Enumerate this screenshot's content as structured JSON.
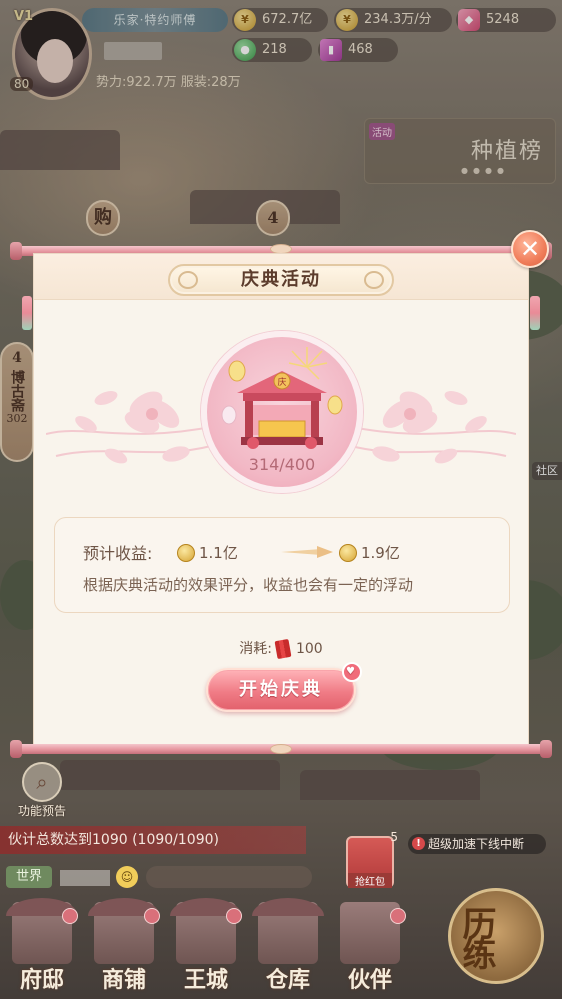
{
  "hud": {
    "vip": "V1",
    "level": "80",
    "title": "乐家·特约师傅",
    "power_label": "势力:922.7万 服装:28万",
    "resources": [
      {
        "name": "silver",
        "icon": "coin-icon",
        "value": "672.7亿"
      },
      {
        "name": "income_rate",
        "icon": "coin-stack-icon",
        "value": "234.3万/分"
      },
      {
        "name": "gems",
        "icon": "gem-icon",
        "value": "5248"
      },
      {
        "name": "jade",
        "icon": "jade-icon",
        "value": "218"
      },
      {
        "name": "cards",
        "icon": "card-icon",
        "value": "468"
      }
    ],
    "plant_ranking": {
      "tag": "活动",
      "title": "种植榜"
    }
  },
  "side": {
    "shop_badge": "购",
    "count_badge": "4",
    "bogu_count": "4",
    "bogu_label": "博古斋",
    "bogu_value": "302",
    "community": "社区"
  },
  "dialog": {
    "title": "庆典活动",
    "progress": "314/400",
    "income_label": "预计收益:",
    "income_from": "1.1亿",
    "income_to": "1.9亿",
    "note": "根据庆典活动的效果评分，收益也会有一定的浮动",
    "cost_label": "消耗:",
    "cost_value": "100",
    "start_button": "开始庆典"
  },
  "bottom": {
    "feature_preview": "功能预告",
    "progress_text": "伙计总数达到1090 (1090/1090)",
    "red_packet": {
      "label": "抢红包",
      "count": "5"
    },
    "speedup_notice": "超级加速下线中断",
    "chat_channel": "世界",
    "nav": [
      "府邸",
      "商铺",
      "王城",
      "仓库",
      "伙伴"
    ],
    "training": "历练"
  },
  "colors": {
    "accent_pink": "#f07c86",
    "dialog_bg": "#f9f4ec",
    "text_brown": "#6e5546",
    "close_orange": "#f07d5a"
  }
}
